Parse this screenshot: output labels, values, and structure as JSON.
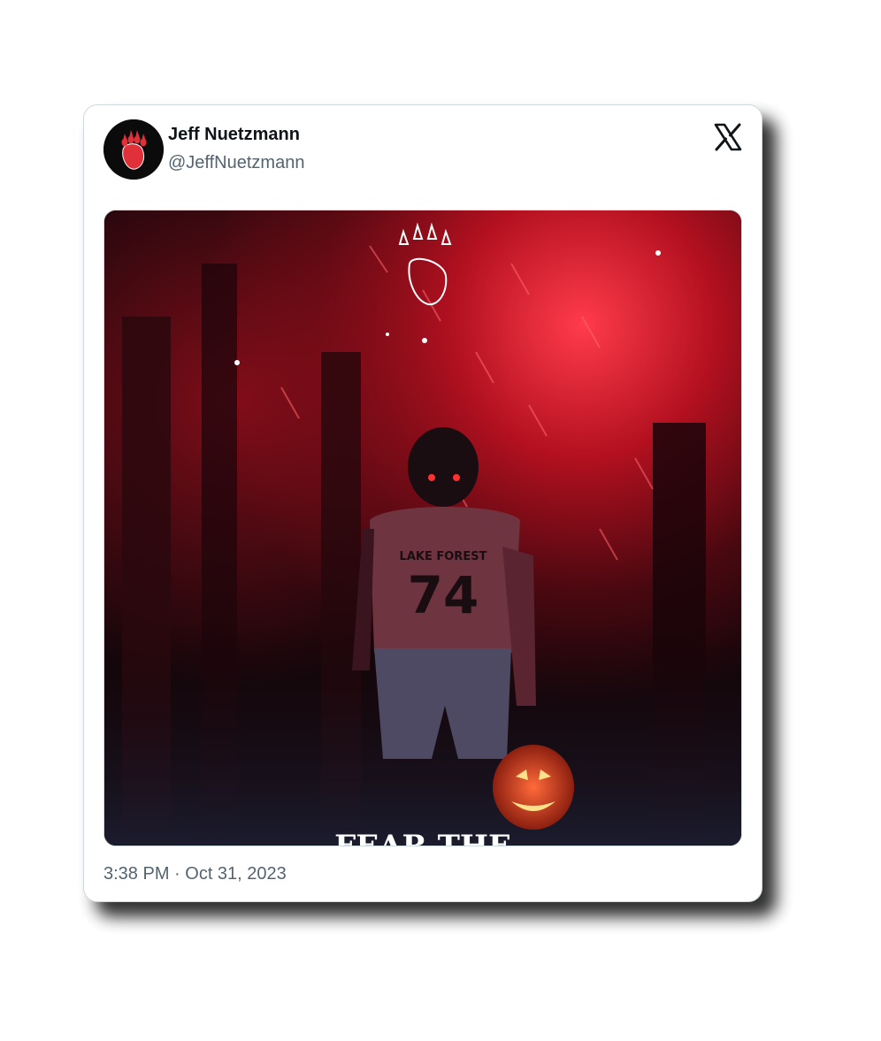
{
  "tweet": {
    "display_name": "Jeff Nuetzmann",
    "handle": "@JeffNuetzmann",
    "time": "3:38 PM",
    "separator": " · ",
    "date": "Oct 31, 2023"
  },
  "media": {
    "jersey_school": "LAKE FOREST",
    "jersey_number": "74",
    "caption_text": "FEAR THE"
  },
  "icons": {
    "avatar": "bear-paw-logo",
    "platform": "x-logo-icon"
  },
  "colors": {
    "text_primary": "#0f1419",
    "text_secondary": "#536471",
    "border": "#cfd9de",
    "paw_red": "#e0303a"
  }
}
